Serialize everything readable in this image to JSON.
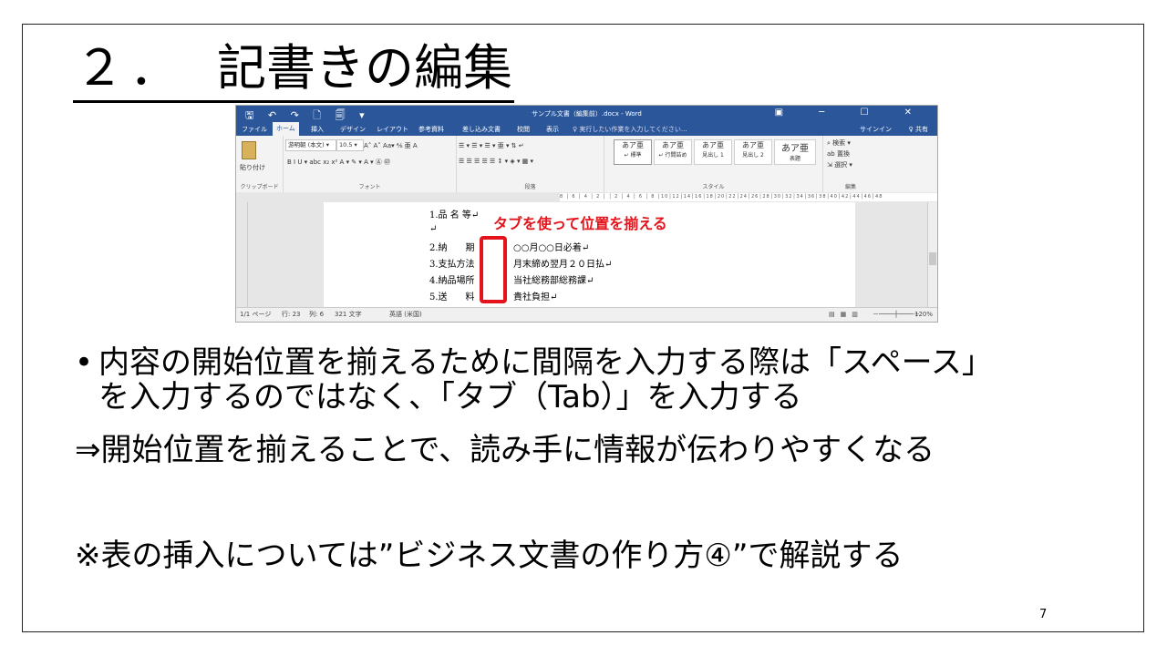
{
  "slide": {
    "title_num": "２．",
    "title_text": "記書きの編集",
    "bullet_1_line1": "内容の開始位置を揃えるために間隔を入力する際は「スペース」",
    "bullet_1_line2": "を入力するのではなく、「タブ（Tab）」を入力する",
    "arrow_line": "⇒開始位置を揃えることで、読み手に情報が伝わりやすくなる",
    "note_line": "※表の挿入については”ビジネス文書の作り方④”で解説する",
    "page_number": "7",
    "bullet_symbol": "•"
  },
  "word": {
    "window_title": "サンプル文書（編集前）.docx - Word",
    "quick_access": "🖫 ↶ ↷ 🗋 🗐 ▾",
    "window_controls": "▣ ─ ☐ ✕",
    "tabs": [
      "ファイル",
      "ホーム",
      "挿入",
      "デザイン",
      "レイアウト",
      "参考資料",
      "差し込み文書",
      "校閲",
      "表示"
    ],
    "tell_me": "♀ 実行したい作業を入力してください...",
    "sign_in": "サインイン",
    "share": "♀ 共有",
    "ribbon": {
      "paste": "貼り付け",
      "font_name": "游明朝 (本文) ▾",
      "font_size": "10.5 ▾",
      "font_tools": "A˄ A˅  Aa▾  ⅍ 亜 A",
      "format_tools": "B  I  U ▾ abc x₂ x²  A ▾ ✎ ▾ A ▾ Ⓐ ㊞",
      "para_tools_1": "☰ ▾ ☰ ▾ ☰ ▾  亜 ▾  ⇅  ↵",
      "para_tools_2": "☰ ☰ ☰ ☰ ☰  ↕ ▾  ◈ ▾ ▦ ▾",
      "groups": [
        "クリップボード",
        "フォント",
        "段落",
        "スタイル",
        "編集"
      ],
      "styles": [
        {
          "sample": "あア亜",
          "name": "↵ 標準"
        },
        {
          "sample": "あア亜",
          "name": "↵ 行間詰め"
        },
        {
          "sample": "あア亜",
          "name": "見出し 1"
        },
        {
          "sample": "あア亜",
          "name": "見出し 2"
        },
        {
          "sample": "あア亜",
          "name": "表題"
        }
      ],
      "edit_items": [
        "⌕ 検索 ▾",
        "ab 置換",
        "⇲ 選択 ▾"
      ]
    },
    "ruler_numbers": "8 │ 6 │ 4 │ 2 │   │ 2 │ 4 │ 6 │ 8 │10│12│14│16│18│20│22│24│26│28│30│32│34│36│38│40│42│44│46│48",
    "document_lines": [
      {
        "label": "1.品 名 等↵",
        "value": ""
      },
      {
        "label": "↵",
        "value": ""
      },
      {
        "label": "2.納　　期",
        "value": "○○月○○日必着↵"
      },
      {
        "label": "3.支払方法",
        "value": "月末締め翌月２０日払↵"
      },
      {
        "label": "4.納品場所",
        "value": "当社総務部総務課↵"
      },
      {
        "label": "5.送　　料",
        "value": "貴社負担↵"
      }
    ],
    "callout": "タブを使って位置を揃える",
    "status": {
      "page": "1/1 ページ",
      "line": "行: 23",
      "col": "列: 6",
      "chars": "321 文字",
      "lang": "英語 (米国)",
      "zoom": "120%"
    }
  }
}
